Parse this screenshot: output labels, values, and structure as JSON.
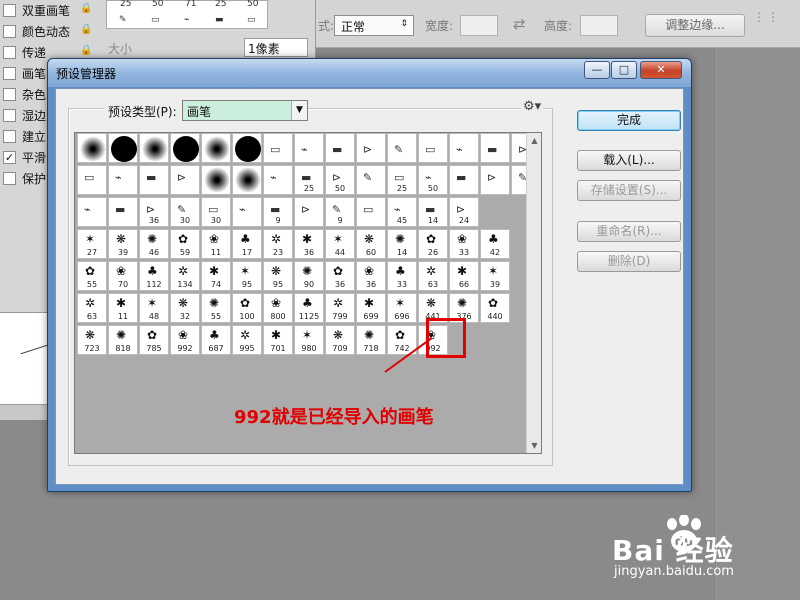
{
  "options_bar": {
    "mode_label": "式:",
    "mode_value": "正常",
    "width_label": "宽度:",
    "height_label": "高度:",
    "refine_button": "调整边缘..."
  },
  "brush_panel": {
    "settings": [
      {
        "label": "双重画笔",
        "checked": false,
        "locked": true
      },
      {
        "label": "颜色动态",
        "checked": false,
        "locked": true
      },
      {
        "label": "传递",
        "checked": false,
        "locked": true
      },
      {
        "label": "画笔",
        "checked": false,
        "locked": false
      },
      {
        "label": "杂色",
        "checked": false,
        "locked": false
      },
      {
        "label": "湿边",
        "checked": false,
        "locked": false
      },
      {
        "label": "建立",
        "checked": false,
        "locked": false
      },
      {
        "label": "平滑",
        "checked": true,
        "locked": false
      },
      {
        "label": "保护",
        "checked": false,
        "locked": false
      }
    ],
    "tip_strip_numbers": [
      "25",
      "50",
      "71",
      "25",
      "50"
    ],
    "size_label": "大小",
    "size_value": "1像素"
  },
  "dialog": {
    "title": "预设管理器",
    "window_controls": {
      "minimize": "—",
      "maximize": "□",
      "close": "✕"
    },
    "preset_type_label": "预设类型(P):",
    "preset_type_value": "画笔",
    "buttons": {
      "done": "完成",
      "load": "载入(L)...",
      "save": "存储设置(S)...",
      "rename": "重命名(R)...",
      "delete": "删除(D)"
    },
    "brush_rows": [
      [
        "",
        "",
        "",
        "",
        "",
        "",
        "",
        "",
        "",
        "",
        "",
        "",
        "",
        "",
        ""
      ],
      [
        "",
        "",
        "",
        "",
        "",
        "",
        "",
        "25",
        "50",
        "",
        "25",
        "50",
        "",
        "",
        ""
      ],
      [
        "",
        "",
        "36",
        "30",
        "30",
        "",
        "9",
        "",
        "9",
        "",
        "45",
        "14",
        "24"
      ],
      [
        "27",
        "39",
        "46",
        "59",
        "11",
        "17",
        "23",
        "36",
        "44",
        "60",
        "14",
        "26",
        "33",
        "42"
      ],
      [
        "55",
        "70",
        "112",
        "134",
        "74",
        "95",
        "95",
        "90",
        "36",
        "36",
        "33",
        "63",
        "66",
        "39"
      ],
      [
        "63",
        "11",
        "48",
        "32",
        "55",
        "100",
        "800",
        "1125",
        "799",
        "699",
        "696",
        "441",
        "376",
        "440"
      ],
      [
        "723",
        "818",
        "785",
        "992",
        "687",
        "995",
        "701",
        "980",
        "709",
        "718",
        "742",
        "992"
      ]
    ],
    "annotation": "992就是已经导入的画笔"
  },
  "watermark": {
    "brand": "Bai  经验",
    "url": "jingyan.baidu.com"
  },
  "colors": {
    "accent_red": "#e00000",
    "title_blue": "#93b6df",
    "select_bg": "#cceedd"
  }
}
